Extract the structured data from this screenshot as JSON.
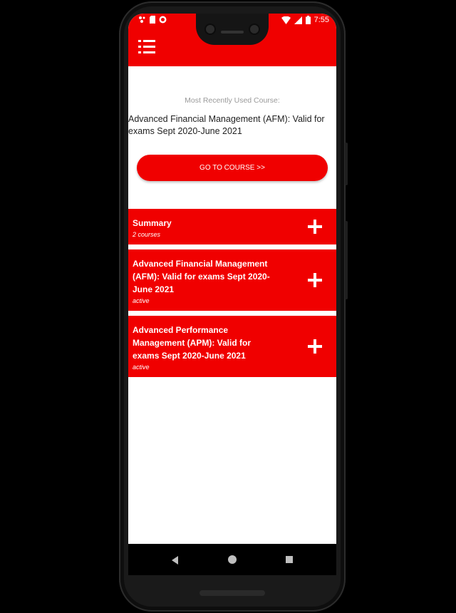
{
  "status_bar": {
    "time": "7:55",
    "icons_left": [
      "notification-icon",
      "sim-icon",
      "record-icon"
    ],
    "icons_right": [
      "wifi-icon",
      "signal-icon",
      "battery-icon"
    ]
  },
  "app_bar": {
    "menu_icon": "list-menu-icon"
  },
  "recent": {
    "label": "Most Recently Used Course:",
    "course_title": "Advanced Financial Management (AFM): Valid for exams Sept 2020-June 2021",
    "go_button_label": "GO TO COURSE >>"
  },
  "courses": [
    {
      "title": "Summary",
      "subtitle": "2 courses"
    },
    {
      "title": "Advanced Financial Management (AFM): Valid for exams Sept 2020-June 2021",
      "subtitle": "active"
    },
    {
      "title": "Advanced Performance Management (APM): Valid for exams Sept 2020-June 2021",
      "subtitle": "active"
    }
  ],
  "nav_bar": {
    "icons": [
      "back-icon",
      "home-icon",
      "recents-icon"
    ]
  },
  "colors": {
    "accent": "#f00000",
    "background": "#ffffff",
    "muted_text": "#9a9a9a"
  }
}
